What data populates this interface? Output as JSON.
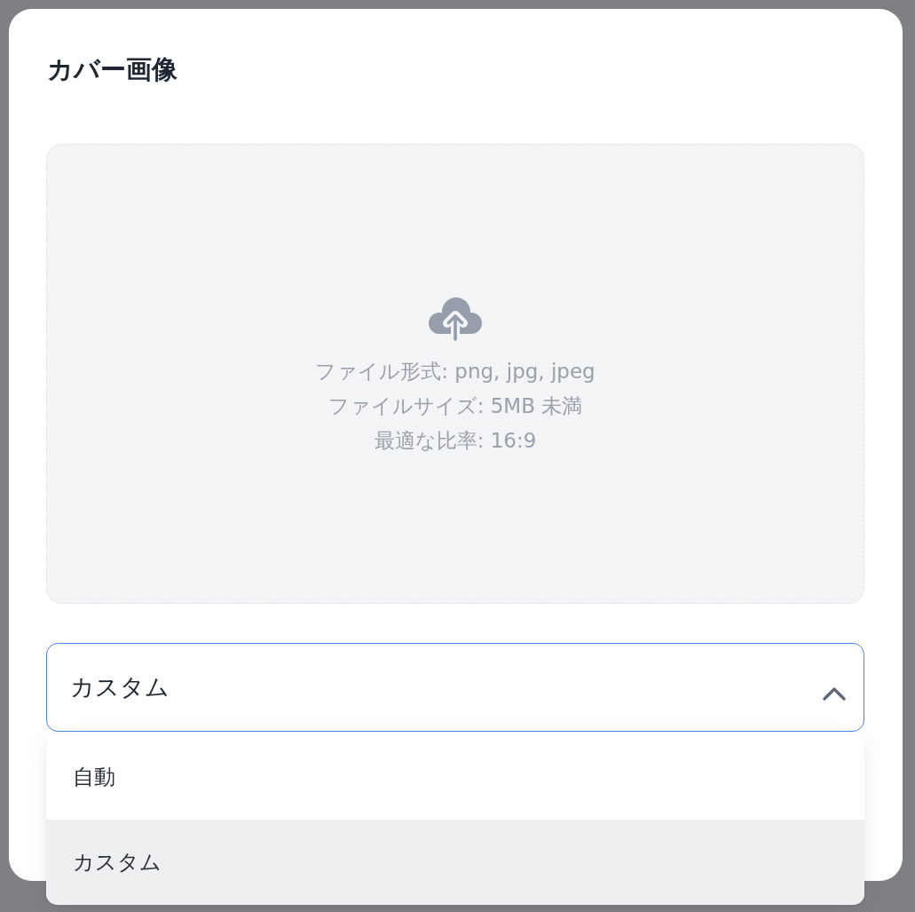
{
  "dialog": {
    "title": "カバー画像"
  },
  "upload_area": {
    "hints": [
      "ファイル形式: png, jpg, jpeg",
      "ファイルサイズ: 5MB 未満",
      "最適な比率: 16:9"
    ]
  },
  "select": {
    "value": "カスタム",
    "expanded": true,
    "options": [
      {
        "label": "自動",
        "selected": false
      },
      {
        "label": "カスタム",
        "selected": true
      }
    ]
  }
}
